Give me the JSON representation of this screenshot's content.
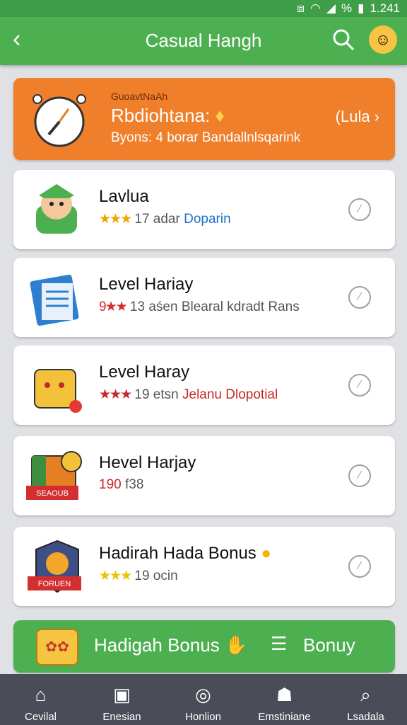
{
  "status": {
    "wifi_icon": "wifi-icon",
    "battery_text": "1.241",
    "signal_text": "%"
  },
  "appbar": {
    "title": "Casual Hangh"
  },
  "banner": {
    "small": "GuoavtNaAh",
    "big": "Rbdiohtana: ",
    "sub": "Byons: 4 borar Bandallnlsqarink",
    "cta": "(Lula ›"
  },
  "cards": [
    {
      "name": "Lavlua",
      "stars": "★★★",
      "count": "17 adar",
      "extra": "Doparin",
      "extra_color": "#1a73c8"
    },
    {
      "name": "Level Hariay",
      "stars": "9★★",
      "count": "13 aśen",
      "extra": "Blearal kdradt Rans",
      "extra_color": "#555555"
    },
    {
      "name": "Level Haray",
      "stars": "★★★",
      "count": "19 etsn",
      "extra": "Jelanu Dlopotial",
      "extra_color": "#c62828"
    },
    {
      "name": "Hevel Harjay",
      "stars": "",
      "count": "190",
      "extra": "f38",
      "extra_color": "#555555"
    },
    {
      "name": "Hadirah Hada Bonus",
      "stars": "★★★",
      "count": "19 ocin",
      "extra": "",
      "extra_color": "#555555"
    }
  ],
  "bonus": {
    "left": "Hadigah Bonus",
    "right": "Bonuy"
  },
  "tabs": [
    {
      "label": "Cevilal",
      "icon": "home-icon"
    },
    {
      "label": "Enesian",
      "icon": "calendar-icon"
    },
    {
      "label": "Honlion",
      "icon": "compass-icon"
    },
    {
      "label": "Emstiniane",
      "icon": "badge-icon"
    },
    {
      "label": "Lsadala",
      "icon": "search-icon"
    }
  ],
  "colors": {
    "primary": "#4caf50",
    "banner": "#ef7f2b",
    "tabbar": "#4a4d57"
  }
}
